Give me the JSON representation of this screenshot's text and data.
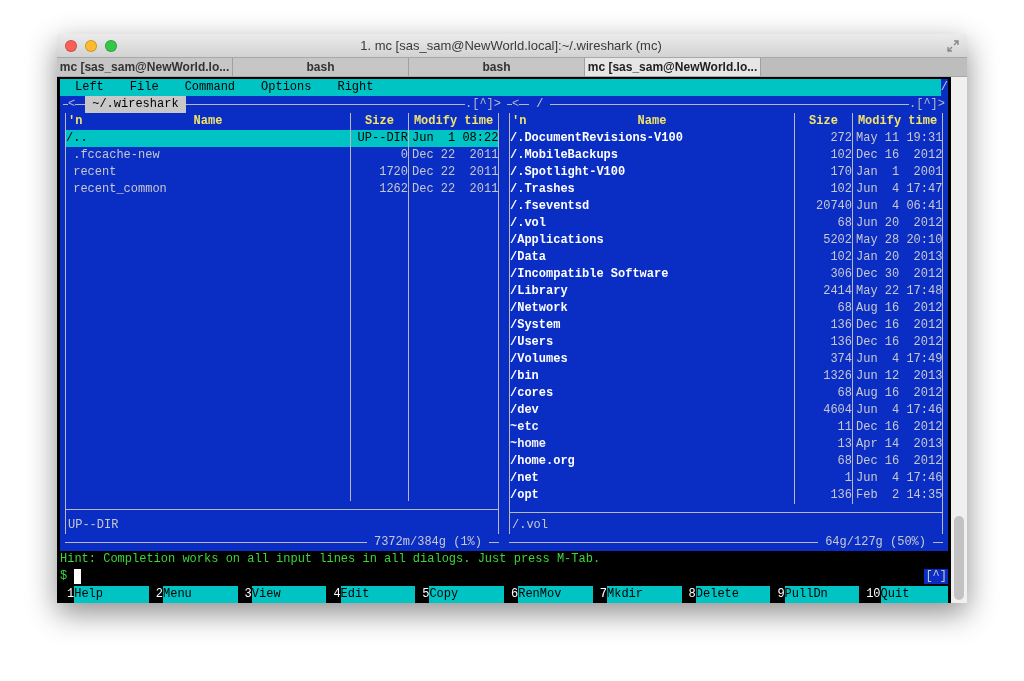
{
  "window": {
    "title": "1. mc [sas_sam@NewWorld.local]:~/.wireshark (mc)"
  },
  "tabs": [
    {
      "label": "mc [sas_sam@NewWorld.lo...",
      "selected": false
    },
    {
      "label": "bash",
      "selected": false
    },
    {
      "label": "bash",
      "selected": false
    },
    {
      "label": "mc [sas_sam@NewWorld.lo...",
      "selected": true
    }
  ],
  "menu_bar": {
    "items": [
      "Left",
      "File",
      "Command",
      "Options",
      "Right"
    ],
    "indicator": "/"
  },
  "panels": [
    {
      "active": true,
      "history": "<",
      "path": "~/.wireshark",
      "controls": ".[^]>",
      "columns": [
        "'n",
        "Name",
        "Size",
        "Modify time"
      ],
      "rows": [
        {
          "name": "/..",
          "size": "UP--DIR",
          "time": "Jun  1 08:22",
          "selected": true
        },
        {
          "name": " .fccache-new",
          "size": "0",
          "time": "Dec 22  2011",
          "kind": "file",
          "selected": false
        },
        {
          "name": " recent",
          "size": "1720",
          "time": "Dec 22  2011",
          "kind": "file",
          "selected": false
        },
        {
          "name": " recent_common",
          "size": "1262",
          "time": "Dec 22  2011",
          "kind": "file",
          "selected": false
        }
      ],
      "mini_status": "UP--DIR",
      "free_space": "7372m/384g (1%)"
    },
    {
      "active": false,
      "history": "<",
      "path": "/",
      "controls": ".[^]>",
      "columns": [
        "'n",
        "Name",
        "Size",
        "Modify time"
      ],
      "rows": [
        {
          "name": "/.DocumentRevisions-V100",
          "size": "272",
          "time": "May 11 19:31",
          "kind": "dir",
          "selected": false
        },
        {
          "name": "/.MobileBackups",
          "size": "102",
          "time": "Dec 16  2012",
          "kind": "dir",
          "selected": false
        },
        {
          "name": "/.Spotlight-V100",
          "size": "170",
          "time": "Jan  1  2001",
          "kind": "dir",
          "selected": false
        },
        {
          "name": "/.Trashes",
          "size": "102",
          "time": "Jun  4 17:47",
          "kind": "dir",
          "selected": false
        },
        {
          "name": "/.fseventsd",
          "size": "20740",
          "time": "Jun  4 06:41",
          "kind": "dir",
          "selected": false
        },
        {
          "name": "/.vol",
          "size": "68",
          "time": "Jun 20  2012",
          "kind": "dir",
          "selected": false
        },
        {
          "name": "/Applications",
          "size": "5202",
          "time": "May 28 20:10",
          "kind": "dir",
          "selected": false
        },
        {
          "name": "/Data",
          "size": "102",
          "time": "Jan 20  2013",
          "kind": "dir",
          "selected": false
        },
        {
          "name": "/Incompatible Software",
          "size": "306",
          "time": "Dec 30  2012",
          "kind": "dir",
          "selected": false
        },
        {
          "name": "/Library",
          "size": "2414",
          "time": "May 22 17:48",
          "kind": "dir",
          "selected": false
        },
        {
          "name": "/Network",
          "size": "68",
          "time": "Aug 16  2012",
          "kind": "dir",
          "selected": false
        },
        {
          "name": "/System",
          "size": "136",
          "time": "Dec 16  2012",
          "kind": "dir",
          "selected": false
        },
        {
          "name": "/Users",
          "size": "136",
          "time": "Dec 16  2012",
          "kind": "dir",
          "selected": false
        },
        {
          "name": "/Volumes",
          "size": "374",
          "time": "Jun  4 17:49",
          "kind": "dir",
          "selected": false
        },
        {
          "name": "/bin",
          "size": "1326",
          "time": "Jun 12  2013",
          "kind": "dir",
          "selected": false
        },
        {
          "name": "/cores",
          "size": "68",
          "time": "Aug 16  2012",
          "kind": "dir",
          "selected": false
        },
        {
          "name": "/dev",
          "size": "4604",
          "time": "Jun  4 17:46",
          "kind": "dir",
          "selected": false
        },
        {
          "name": "~etc",
          "size": "11",
          "time": "Dec 16  2012",
          "kind": "link",
          "selected": false
        },
        {
          "name": "~home",
          "size": "13",
          "time": "Apr 14  2013",
          "kind": "link",
          "selected": false
        },
        {
          "name": "/home.org",
          "size": "68",
          "time": "Dec 16  2012",
          "kind": "dir",
          "selected": false
        },
        {
          "name": "/net",
          "size": "1",
          "time": "Jun  4 17:46",
          "kind": "dir",
          "selected": false
        },
        {
          "name": "/opt",
          "size": "136",
          "time": "Feb  2 14:35",
          "kind": "dir",
          "selected": false
        }
      ],
      "mini_status": "/.vol",
      "free_space": "64g/127g (50%)"
    }
  ],
  "hint": "Hint: Completion works on all input lines in all dialogs. Just press M-Tab.",
  "prompt": "$",
  "scroll_marker": "[^]",
  "keybar": [
    {
      "key": "1",
      "label": "Help"
    },
    {
      "key": "2",
      "label": "Menu"
    },
    {
      "key": "3",
      "label": "View"
    },
    {
      "key": "4",
      "label": "Edit"
    },
    {
      "key": "5",
      "label": "Copy"
    },
    {
      "key": "6",
      "label": "RenMov"
    },
    {
      "key": "7",
      "label": "Mkdir"
    },
    {
      "key": "8",
      "label": "Delete"
    },
    {
      "key": "9",
      "label": "PullDn"
    },
    {
      "key": "10",
      "label": "Quit"
    }
  ]
}
